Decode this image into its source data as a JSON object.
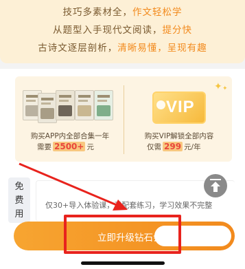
{
  "promo": {
    "line1_plain": "技巧多素材全，",
    "line1_hl": "作文轻松学",
    "line2_plain": "从题型入手现代文阅读，",
    "line2_hl": "提分快",
    "line3_plain": "古诗文逐层剖析，",
    "line3_hl": "清晰易懂，呈现有趣"
  },
  "compare": {
    "left_caption": "购买APP内全部合集一年",
    "left_prefix": "需要",
    "left_price": "2500+",
    "left_suffix": "元",
    "vip_label": "VIP",
    "right_caption": "购买VIP解锁全部内容",
    "right_prefix": "仅需",
    "right_price": "299",
    "right_suffix": "元/年"
  },
  "trial": {
    "tag_chars": [
      "免",
      "费",
      "用"
    ],
    "text": "仅30+导入体验课，无配套练习，学习效果不完整"
  },
  "cta": {
    "label": "立即升级钻石会"
  },
  "colors": {
    "accent": "#f28a1d",
    "annotation": "#e8231d",
    "promo_bg": "#fdf0d6"
  },
  "icons": {
    "scroll_top": "arrow-up-icon",
    "vip": "vip-badge-icon",
    "sparkle": "sparkle-icon"
  }
}
